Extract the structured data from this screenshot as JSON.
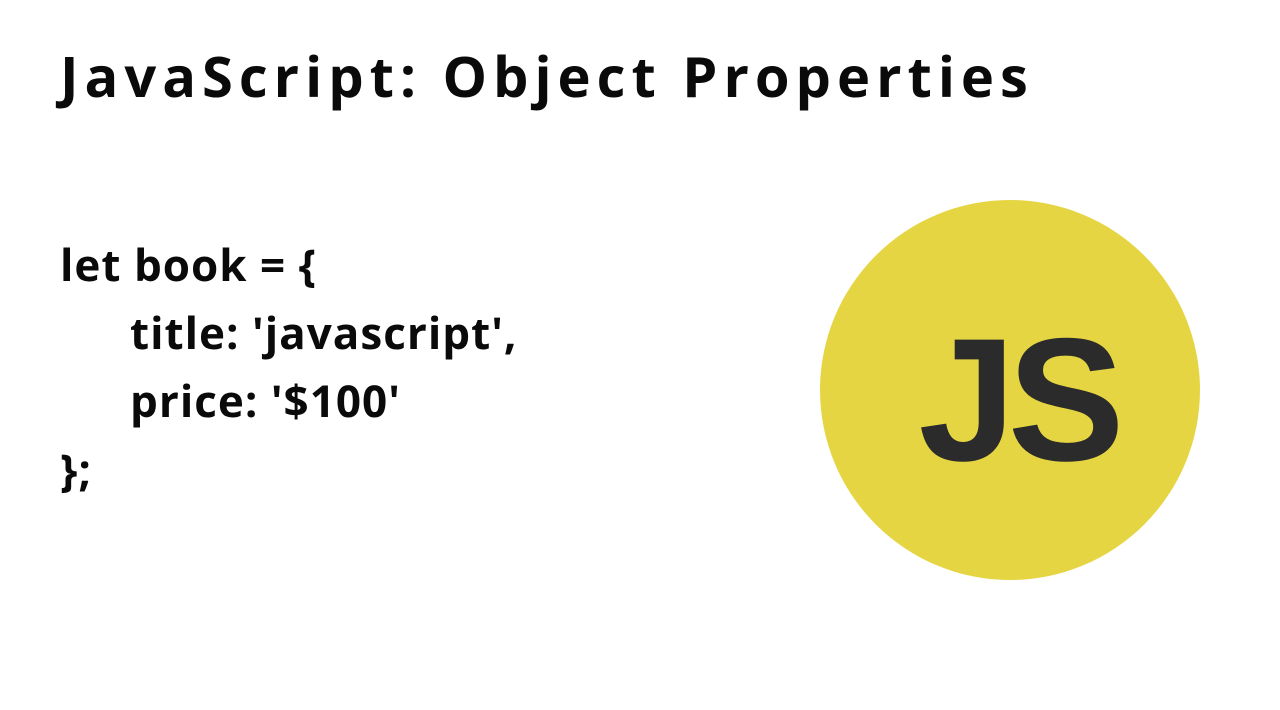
{
  "title": "JavaScript: Object Properties",
  "code": {
    "line1": "let book = {",
    "line2": "title: 'javascript',",
    "line3": "price: '$100'",
    "line4": "};"
  },
  "logo": {
    "text": "JS",
    "bg_color": "#e6d542",
    "text_color": "#2b2b2b"
  }
}
